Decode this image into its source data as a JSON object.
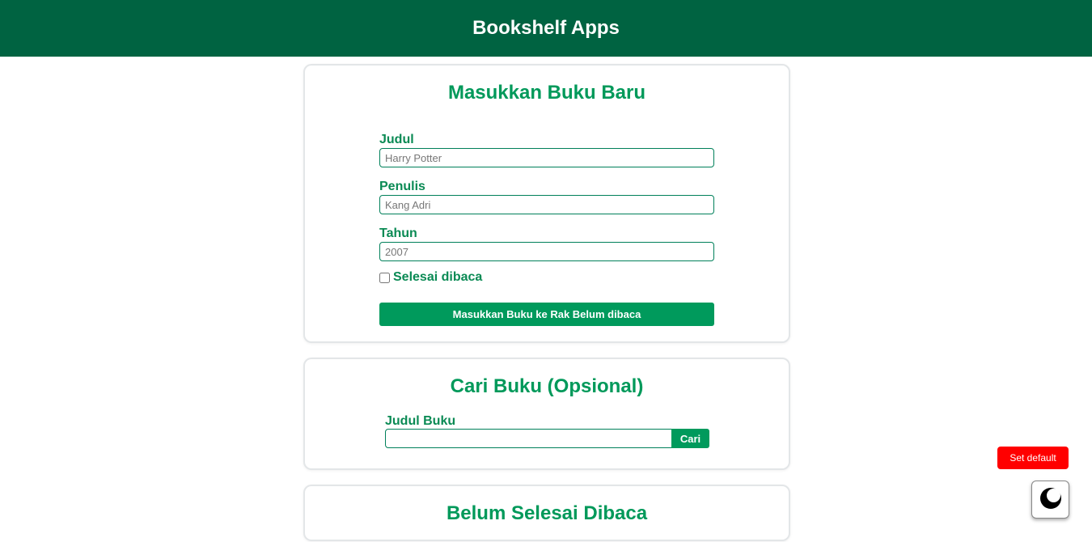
{
  "header": {
    "title": "Bookshelf Apps"
  },
  "input_section": {
    "title": "Masukkan Buku Baru",
    "fields": [
      {
        "label": "Judul",
        "placeholder": "Harry Potter"
      },
      {
        "label": "Penulis",
        "placeholder": "Kang Adri"
      },
      {
        "label": "Tahun",
        "placeholder": "2007"
      }
    ],
    "checkbox_label": "Selesai dibaca",
    "checkbox_checked": false,
    "submit_label": "Masukkan Buku ke Rak Belum dibaca"
  },
  "search_section": {
    "title": "Cari Buku (Opsional)",
    "label": "Judul Buku",
    "value": "",
    "button_label": "Cari"
  },
  "unread_section": {
    "title": "Belum Selesai Dibaca"
  },
  "floating": {
    "reset_label": "Set default",
    "theme_icon": "moon-icon"
  },
  "colors": {
    "header_bg": "#006341",
    "accent": "#009a5c",
    "heading": "#00995a",
    "reset": "#ff0000"
  }
}
